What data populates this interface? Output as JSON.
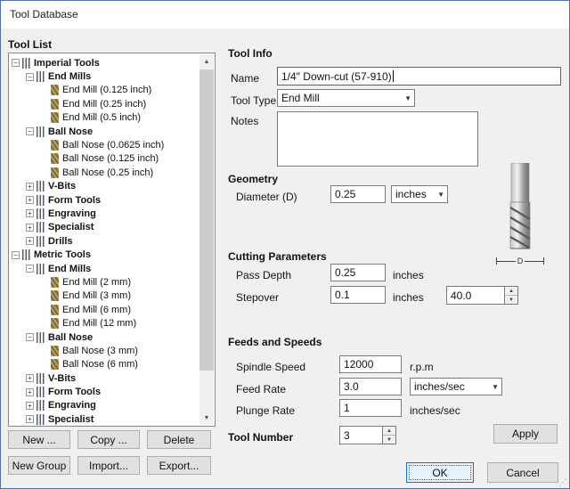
{
  "window": {
    "title": "Tool Database"
  },
  "tool_list": {
    "label": "Tool List",
    "tree": [
      {
        "label": "Imperial Tools",
        "level": 0,
        "type": "group",
        "expander": "minus"
      },
      {
        "label": "End Mills",
        "level": 1,
        "type": "group",
        "expander": "minus"
      },
      {
        "label": "End Mill (0.125 inch)",
        "level": 2,
        "type": "tool"
      },
      {
        "label": "End Mill (0.25 inch)",
        "level": 2,
        "type": "tool"
      },
      {
        "label": "End Mill (0.5 inch)",
        "level": 2,
        "type": "tool"
      },
      {
        "label": "Ball Nose",
        "level": 1,
        "type": "group",
        "expander": "minus"
      },
      {
        "label": "Ball Nose (0.0625 inch)",
        "level": 2,
        "type": "tool"
      },
      {
        "label": "Ball Nose (0.125 inch)",
        "level": 2,
        "type": "tool"
      },
      {
        "label": "Ball Nose (0.25 inch)",
        "level": 2,
        "type": "tool"
      },
      {
        "label": "V-Bits",
        "level": 1,
        "type": "group",
        "expander": "plus"
      },
      {
        "label": "Form Tools",
        "level": 1,
        "type": "group",
        "expander": "plus"
      },
      {
        "label": "Engraving",
        "level": 1,
        "type": "group",
        "expander": "plus"
      },
      {
        "label": "Specialist",
        "level": 1,
        "type": "group",
        "expander": "plus"
      },
      {
        "label": "Drills",
        "level": 1,
        "type": "group",
        "expander": "plus"
      },
      {
        "label": "Metric Tools",
        "level": 0,
        "type": "group",
        "expander": "minus"
      },
      {
        "label": "End Mills",
        "level": 1,
        "type": "group",
        "expander": "minus"
      },
      {
        "label": "End Mill (2 mm)",
        "level": 2,
        "type": "tool"
      },
      {
        "label": "End Mill (3 mm)",
        "level": 2,
        "type": "tool"
      },
      {
        "label": "End Mill (6 mm)",
        "level": 2,
        "type": "tool"
      },
      {
        "label": "End Mill (12 mm)",
        "level": 2,
        "type": "tool"
      },
      {
        "label": "Ball Nose",
        "level": 1,
        "type": "group",
        "expander": "minus"
      },
      {
        "label": "Ball Nose (3 mm)",
        "level": 2,
        "type": "tool"
      },
      {
        "label": "Ball Nose (6 mm)",
        "level": 2,
        "type": "tool"
      },
      {
        "label": "V-Bits",
        "level": 1,
        "type": "group",
        "expander": "plus"
      },
      {
        "label": "Form Tools",
        "level": 1,
        "type": "group",
        "expander": "plus"
      },
      {
        "label": "Engraving",
        "level": 1,
        "type": "group",
        "expander": "plus"
      },
      {
        "label": "Specialist",
        "level": 1,
        "type": "group",
        "expander": "plus"
      }
    ],
    "buttons": {
      "new": "New ...",
      "copy": "Copy ...",
      "delete": "Delete",
      "new_group": "New Group",
      "import": "Import...",
      "export": "Export..."
    }
  },
  "tool_info": {
    "heading": "Tool Info",
    "name_label": "Name",
    "name_value": "1/4\" Down-cut (57-910)",
    "tool_type_label": "Tool Type",
    "tool_type_value": "End Mill",
    "notes_label": "Notes",
    "notes_value": ""
  },
  "geometry": {
    "heading": "Geometry",
    "diameter_label": "Diameter (D)",
    "diameter_value": "0.25",
    "diameter_units": "inches",
    "dimension_label": "D"
  },
  "cutting_parameters": {
    "heading": "Cutting Parameters",
    "pass_depth_label": "Pass Depth",
    "pass_depth_value": "0.25",
    "pass_depth_units": "inches",
    "stepover_label": "Stepover",
    "stepover_value": "0.1",
    "stepover_units": "inches",
    "stepover_percent": "40.0"
  },
  "feeds_and_speeds": {
    "heading": "Feeds and Speeds",
    "spindle_label": "Spindle Speed",
    "spindle_value": "12000",
    "spindle_units": "r.p.m",
    "feed_label": "Feed Rate",
    "feed_value": "3.0",
    "feed_units": "inches/sec",
    "plunge_label": "Plunge Rate",
    "plunge_value": "1",
    "plunge_units": "inches/sec"
  },
  "tool_number": {
    "label": "Tool Number",
    "value": "3"
  },
  "actions": {
    "apply": "Apply",
    "ok": "OK",
    "cancel": "Cancel"
  },
  "colors": {
    "dialog_bg": "#f0f0f0",
    "focus_blue": "#0078d7",
    "control_border": "#7a7a7a"
  }
}
